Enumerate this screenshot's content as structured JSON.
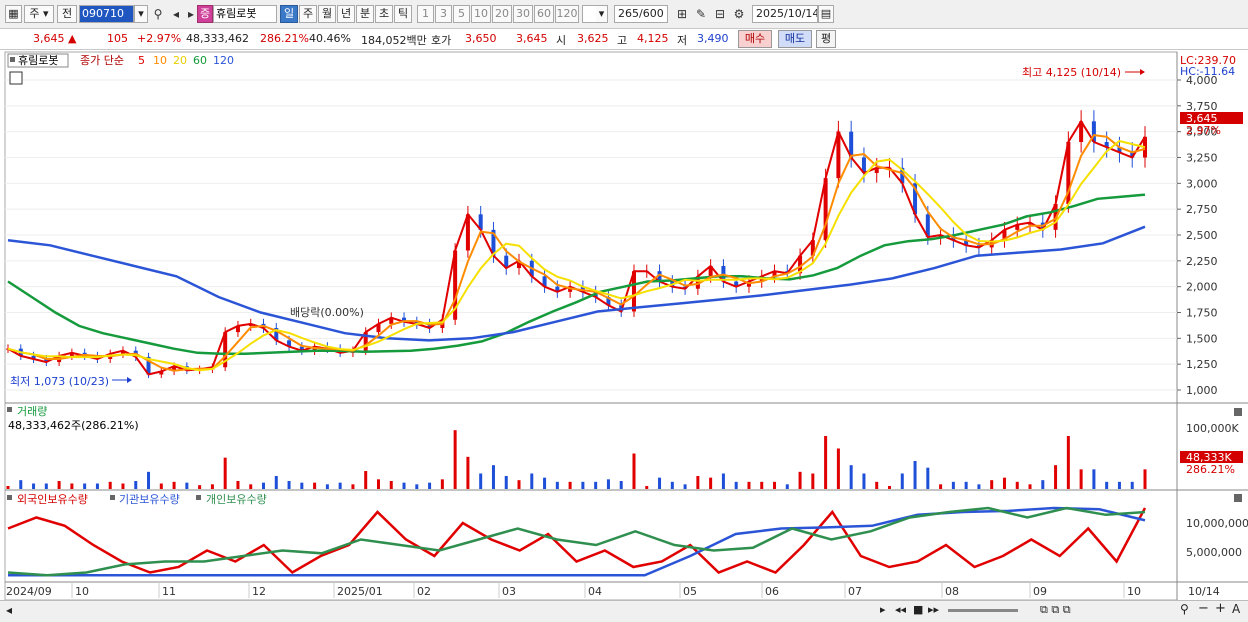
{
  "toolbar": {
    "type_label": "주",
    "all_label": "전",
    "code": "090710",
    "stock_badge": "증",
    "stock_name": "휴림로봇",
    "periods": [
      "일",
      "주",
      "월",
      "년",
      "분",
      "초",
      "틱"
    ],
    "intervals": [
      "1",
      "3",
      "5",
      "10",
      "20",
      "30",
      "60",
      "120"
    ],
    "count": "265",
    "count_max": "/600",
    "date": "2025/10/14"
  },
  "quote": {
    "price": "3,645",
    "change": "105",
    "change_pct": "+2.97%",
    "volume": "48,333,462",
    "volume_ratio": "286.21%",
    "turnover_ratio": "40.46%",
    "amount": "184,052백만",
    "bid_label": "호가",
    "bid1": "3,650",
    "bid2": "3,645",
    "open_label": "시",
    "open": "3,625",
    "high_label": "고",
    "high": "4,125",
    "low_label": "저",
    "low": "3,490",
    "buy_label": "매수",
    "sell_label": "매도",
    "avg_label": "평"
  },
  "price_panel": {
    "name": "휴림로봇",
    "ma_title": "종가 단순",
    "ma_periods": [
      "5",
      "10",
      "20",
      "60",
      "120"
    ],
    "lc": "LC:239.70",
    "hc": "HC:-11.64",
    "current": "3,645",
    "current_pct": "2.97%",
    "high_note": "최고 4,125 (10/14)",
    "low_note": "최저 1,073 (10/23)",
    "event_note": "배당락(0.00%)",
    "y_ticks": [
      "4,000",
      "3,750",
      "3,500",
      "3,250",
      "3,000",
      "2,750",
      "2,500",
      "2,250",
      "2,000",
      "1,750",
      "1,500",
      "1,250",
      "1,000"
    ]
  },
  "volume_panel": {
    "title": "거래량",
    "value": "48,333,462주(286.21%)",
    "y_tick": "100,000K",
    "current": "48,333K",
    "current_pct": "286.21%"
  },
  "holding_panel": {
    "legend": [
      "외국인보유수량",
      "기관보유수량",
      "개인보유수량"
    ],
    "y_ticks": [
      "10,000,000",
      "5,000,000"
    ]
  },
  "x_labels": [
    "2024/09",
    "10",
    "11",
    "12",
    "2025/01",
    "02",
    "03",
    "04",
    "05",
    "06",
    "07",
    "08",
    "09",
    "10",
    "10/14"
  ],
  "colors": {
    "up": "#e00000",
    "down": "#1d4fd8",
    "ma5": "#e00000",
    "ma10": "#ff8c00",
    "ma20": "#f5e000",
    "ma60": "#159a3c",
    "ma120": "#2b55d6",
    "foreign": "#e00000",
    "inst": "#2b55d6",
    "indiv": "#2f8f4f"
  },
  "chart_data": {
    "type": "candlestick",
    "interval": "daily",
    "x_range": [
      "2024-09",
      "2025-10-14"
    ],
    "y_range": [
      1000,
      4000
    ],
    "price_series": [
      {
        "name": "5",
        "values": [
          1400,
          1330,
          1300,
          1270,
          1330,
          1360,
          1330,
          1300,
          1350,
          1380,
          1320,
          1150,
          1180,
          1230,
          1190,
          1200,
          1220,
          1560,
          1620,
          1640,
          1600,
          1480,
          1420,
          1380,
          1420,
          1400,
          1360,
          1380,
          1560,
          1640,
          1700,
          1660,
          1640,
          1600,
          1680,
          2350,
          2700,
          2550,
          2300,
          2180,
          2250,
          2100,
          2000,
          1950,
          2000,
          1950,
          1900,
          1820,
          1760,
          2150,
          2150,
          2050,
          2000,
          1980,
          2100,
          2200,
          2050,
          2000,
          2050,
          2100,
          2150,
          2130,
          2300,
          2450,
          3050,
          3500,
          3250,
          3100,
          3150,
          3150,
          3000,
          2700,
          2480,
          2500,
          2450,
          2400,
          2380,
          2450,
          2550,
          2600,
          2620,
          2550,
          2800,
          3400,
          3600,
          3400,
          3350,
          3300,
          3250,
          3450
        ]
      },
      {
        "name": "60",
        "values": [
          2050,
          1900,
          1750,
          1620,
          1550,
          1500,
          1450,
          1400,
          1360,
          1350,
          1350,
          1360,
          1370,
          1380,
          1380,
          1370,
          1375,
          1380,
          1400,
          1430,
          1470,
          1550,
          1660,
          1760,
          1850,
          1950,
          2000,
          2050,
          2060,
          2080,
          2100,
          2100,
          2080,
          2070,
          2110,
          2180,
          2300,
          2400,
          2440,
          2460,
          2500,
          2550,
          2600,
          2680,
          2720,
          2780,
          2850,
          2870,
          2890
        ]
      },
      {
        "name": "120",
        "values": [
          2450,
          2400,
          2300,
          2200,
          2100,
          1900,
          1750,
          1650,
          1550,
          1500,
          1480,
          1500,
          1560,
          1660,
          1760,
          1800,
          1840,
          1880,
          1920,
          1970,
          2020,
          2080,
          2180,
          2300,
          2330,
          2360,
          2420,
          2580
        ]
      }
    ],
    "volume_max_label": "100,000K",
    "last_volume": 48333462,
    "holding_series": [
      {
        "name": "외국인보유수량",
        "values": [
          9000000,
          11000000,
          9500000,
          6000000,
          3000000,
          1000000,
          2000000,
          5000000,
          3000000,
          6000000,
          1000000,
          4000000,
          6000000,
          12000000,
          7000000,
          4000000,
          10000000,
          7000000,
          5000000,
          8000000,
          3000000,
          5000000,
          2000000,
          3000000,
          6000000,
          1000000,
          3000000,
          1000000,
          6000000,
          12000000,
          4000000,
          2000000,
          3000000,
          6000000,
          2000000,
          4000000,
          7000000,
          4000000,
          9000000,
          3000000,
          14000000
        ]
      },
      {
        "name": "기관보유수량",
        "values": [
          500000,
          500000,
          500000,
          500000,
          500000,
          500000,
          500000,
          500000,
          500000,
          500000,
          500000,
          500000,
          500000,
          500000,
          500000,
          4000000,
          8000000,
          9000000,
          9200000,
          9500000,
          11500000,
          12000000,
          12200000,
          13000000,
          12500000,
          10500000
        ]
      },
      {
        "name": "개인보유수량",
        "values": [
          1000000,
          500000,
          1000000,
          2500000,
          3000000,
          3000000,
          4000000,
          5000000,
          4500000,
          7000000,
          6000000,
          5000000,
          7000000,
          9000000,
          7000000,
          6000000,
          8500000,
          6000000,
          5000000,
          5500000,
          9000000,
          7000000,
          8500000,
          11000000,
          12000000,
          13000000,
          11000000,
          14000000,
          11500000,
          12000000
        ]
      }
    ]
  }
}
